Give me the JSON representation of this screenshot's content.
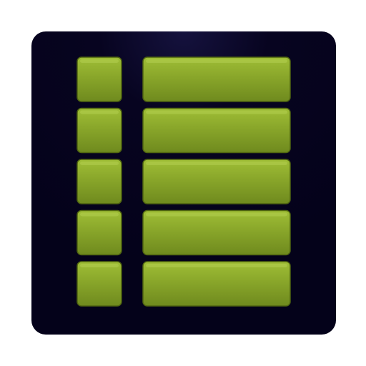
{
  "icon": {
    "name": "list-view-icon",
    "rows": 5,
    "colors": {
      "tile_top": "#15123e",
      "tile_mid": "#070420",
      "tile_bottom": "#04021a",
      "cell_top": "#9fbe36",
      "cell_mid": "#89a62a",
      "cell_bottom": "#6f8a1e",
      "cell_edge": "#4f6410",
      "cell_highlight": "#c2dc62"
    }
  }
}
